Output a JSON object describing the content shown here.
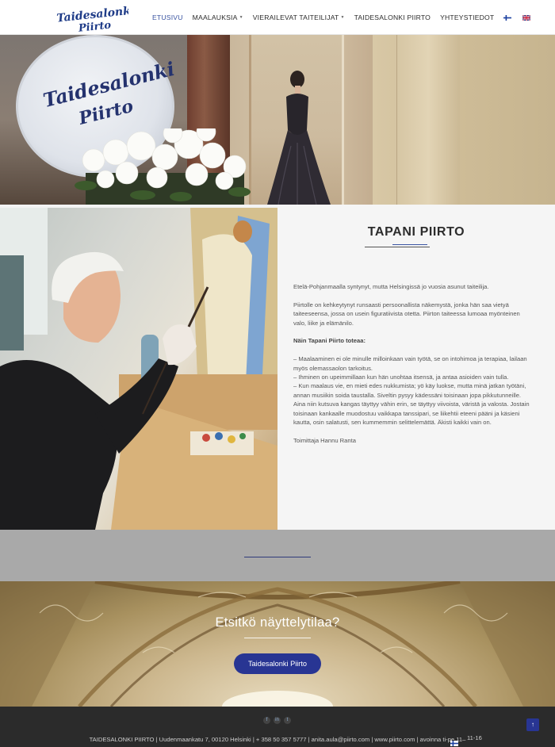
{
  "header": {
    "logo_text": "Taidesalonki Piirto",
    "nav": [
      {
        "label": "ETUSIVU",
        "active": true,
        "dropdown": false
      },
      {
        "label": "MAALAUKSIA",
        "active": false,
        "dropdown": true
      },
      {
        "label": "VIERAILEVAT TAITEILIJAT",
        "active": false,
        "dropdown": true
      },
      {
        "label": "TAIDESALONKI PIIRTO",
        "active": false,
        "dropdown": false
      },
      {
        "label": "YHTEYSTIEDOT",
        "active": false,
        "dropdown": false
      }
    ],
    "languages": [
      "fi-flag-icon",
      "en-flag-icon"
    ]
  },
  "hero": {
    "sign_text": "Taidesalonki Piirto"
  },
  "artist": {
    "title": "TAPANI PIIRTO",
    "paragraphs": [
      "Etelä-Pohjanmaalla syntynyt, mutta Helsingissä jo vuosia asunut taiteilija.",
      "Piirtolle on kehkeytynyt runsaasti persoonallista näkemystä, jonka hän saa vietyä taiteeseensa, jossa on usein figuratiivista otetta. Piirton taiteessa lumoaa myönteinen valo, liike ja elämänilo."
    ],
    "quote_heading": "Näin Tapani Piirto toteaa:",
    "quote_lines": [
      "– Maalaaminen ei ole minulle milloinkaan vain työtä, se on intohimoa ja terapiaa, lailaan myös olemassaolon tarkoitus.",
      "– Ihminen on upeimmillaan kun hän unohtaa itsensä, ja antaa asioiden vain tulla.",
      "– Kun maalaus vie, en mieti edes nukkumista; yö käy luokse, mutta minä jatkan työtäni, annan musiikin soida taustalla. Siveltin pysyy kädessäni toisinaan jopa pikkutunneille. Aina niin kutsuva kangas täyttyy vähin erin, se täyttyy viivoista, väristä ja valosta. Jostain toisinaan kankaalle muodostuu vaikkapa tanssipari, se liikehtii eteeni pääni ja käsieni kautta, osin salatusti, sen kummemmin selittelemättä. Äkisti kaikki vain on."
    ],
    "signature": "Toimittaja Hannu Ranta"
  },
  "cta": {
    "title": "Etsitkö näyttelytilaa?",
    "button_label": "Taidesalonki Piirto"
  },
  "footer": {
    "social": [
      "f",
      "in",
      "t"
    ],
    "info": "TAIDESALONKI PIIRTO | Uudenmaankatu 7, 00120 Helsinki | + 358 50 357 5777 | anita.aula@piirto.com | www.piirto.com | avoinna ti-pe 11–",
    "hours_extra": "11-16",
    "to_top_label": "↑"
  },
  "colors": {
    "accent": "#3b55a2",
    "button": "#283593",
    "footer_bg": "#2b2b2b"
  }
}
